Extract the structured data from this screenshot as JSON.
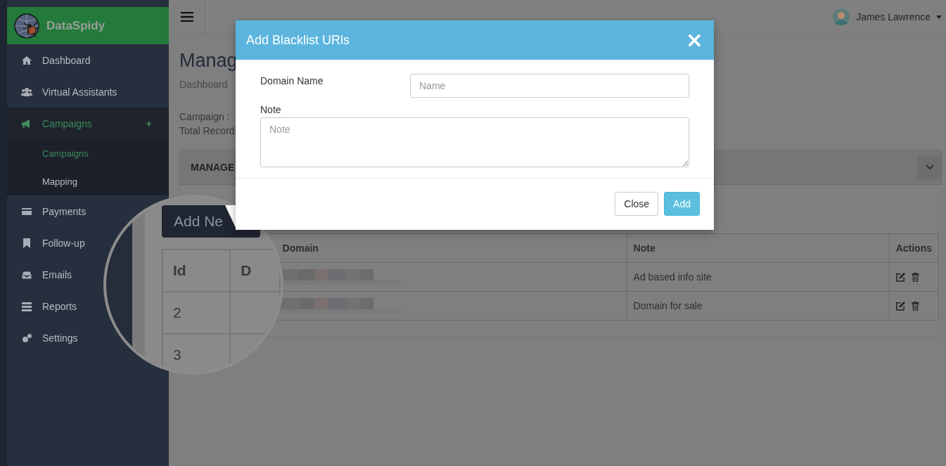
{
  "sidebar": {
    "brand": "DataSpidy",
    "items": [
      {
        "label": "Dashboard",
        "selected": false
      },
      {
        "label": "Virtual Assistants",
        "selected": false
      },
      {
        "label": "Campaigns",
        "selected": true,
        "expanded": true,
        "toggle": "+",
        "children": [
          {
            "label": "Campaigns",
            "selected": true
          },
          {
            "label": "Mapping",
            "selected": false
          }
        ]
      },
      {
        "label": "Payments",
        "selected": false
      },
      {
        "label": "Follow-up",
        "selected": false
      },
      {
        "label": "Emails",
        "selected": false
      },
      {
        "label": "Reports",
        "selected": false
      },
      {
        "label": "Settings",
        "selected": false
      }
    ]
  },
  "topbar": {
    "user": "James Lawrence"
  },
  "page": {
    "title": "Manag",
    "breadcrumb": "Dashboard",
    "info": [
      "Campaign :",
      "Total Record"
    ],
    "panel_title": "MANAGE"
  },
  "table": {
    "columns": [
      "Domain",
      "Note",
      "Actions"
    ],
    "rows": [
      {
        "note": "Ad based info site"
      },
      {
        "note": "Domain for sale"
      }
    ]
  },
  "magnifier": {
    "button": "Add Ne",
    "columns": [
      "Id",
      "D"
    ],
    "rows": [
      "2",
      "3"
    ]
  },
  "modal": {
    "title": "Add Blacklist URls",
    "close": "×",
    "fields": [
      {
        "kind": "input",
        "label": "Domain Name",
        "placeholder": "Name"
      },
      {
        "kind": "textarea",
        "label": "Note",
        "placeholder": "Note"
      }
    ],
    "buttons": [
      {
        "kind": "default",
        "label": "Close"
      },
      {
        "kind": "primary",
        "label": "Add"
      }
    ]
  }
}
